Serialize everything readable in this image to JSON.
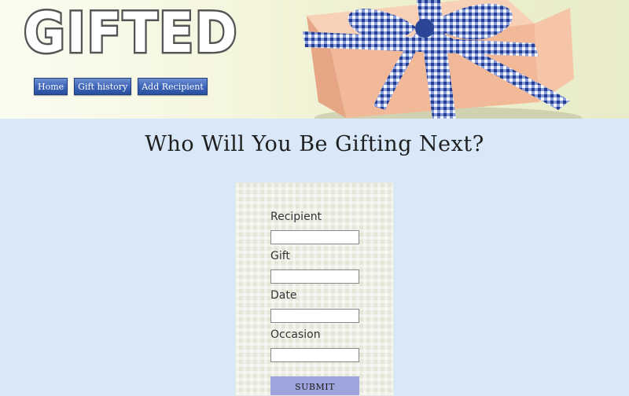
{
  "header": {
    "logo_text": "GIFTED",
    "nav": [
      {
        "label": "Home"
      },
      {
        "label": "Gift history"
      },
      {
        "label": "Add Recipient"
      }
    ]
  },
  "main": {
    "title": "Who Will You Be Gifting Next?",
    "form": {
      "fields": [
        {
          "label": "Recipient",
          "value": ""
        },
        {
          "label": "Gift",
          "value": ""
        },
        {
          "label": "Date",
          "value": ""
        },
        {
          "label": "Occasion",
          "value": ""
        }
      ],
      "submit_label": "SUBMIT"
    }
  },
  "colors": {
    "page_background": "#d8e8f8",
    "nav_button": "#3f66b9",
    "submit_button": "#9ea5dc",
    "ribbon": "#2f4fa0"
  }
}
